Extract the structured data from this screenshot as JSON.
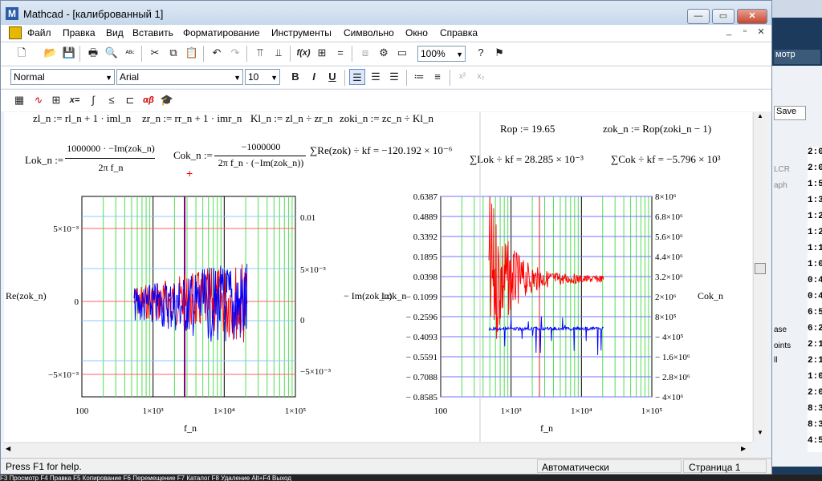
{
  "window": {
    "title": "Mathcad - [калиброванный 1]",
    "icon": "mathcad-icon"
  },
  "menu": [
    "Файл",
    "Правка",
    "Вид",
    "Вставить",
    "Форматирование",
    "Инструменты",
    "Символьно",
    "Окно",
    "Справка"
  ],
  "toolbar": {
    "zoom": "100%"
  },
  "format": {
    "style": "Normal",
    "font": "Arial",
    "size": "10",
    "bold": "B",
    "italic": "I",
    "underline": "U"
  },
  "math_toolbar": {
    "xeq": "x=",
    "alpha": "αβ"
  },
  "worksheet": {
    "row1": {
      "zl": "zl_n := rl_n + 1 · iml_n",
      "zr": "zr_n := rr_n + 1 · imr_n",
      "kl": "Kl_n := zl_n ÷ zr_n",
      "zoki": "zoki_n := zc_n ÷ Kl_n"
    },
    "rop": "Rop := 19.65",
    "zok": "zok_n := Rop(zoki_n − 1)",
    "lok_lhs": "Lok_n :=",
    "lok_num": "1000000 · −Im(zok_n)",
    "lok_den": "2π f_n",
    "cok_lhs": "Cok_n :=",
    "cok_num": "−1000000",
    "cok_den": "2π f_n · (−Im(zok_n))",
    "sum1": "∑Re(zok) ÷ kf = −120.192 × 10⁻⁶",
    "sum2": "∑Lok ÷ kf = 28.285 × 10⁻³",
    "sum3": "∑Cok ÷ kf = −5.796 × 10³"
  },
  "plot1": {
    "y_left_label": "Re(zok_n)",
    "y_right_label": "− Im(zok_n)",
    "x_label": "f_n",
    "y_left_ticks": [
      "5×10⁻³",
      "0",
      "−5×10⁻³"
    ],
    "y_right_ticks": [
      "0.01",
      "5×10⁻³",
      "0",
      "−5×10⁻³"
    ],
    "x_ticks": [
      "100",
      "1×10³",
      "1×10⁴",
      "1×10⁵"
    ]
  },
  "plot2": {
    "y_left_label": "Lok_n",
    "y_right_label": "Cok_n",
    "x_label": "f_n",
    "y_left_ticks": [
      "0.6387",
      "0.4889",
      "0.3392",
      "0.1895",
      "0.0398",
      "− 0.1099",
      "− 0.2596",
      "− 0.4093",
      "− 0.5591",
      "− 0.7088",
      "− 0.8585"
    ],
    "y_right_ticks": [
      "8×10⁶",
      "6.8×10⁶",
      "5.6×10⁶",
      "4.4×10⁶",
      "3.2×10⁶",
      "2×10⁶",
      "8×10⁵",
      "− 4×10⁵",
      "− 1.6×10⁶",
      "− 2.8×10⁶",
      "− 4×10⁶"
    ],
    "x_ticks": [
      "100",
      "1×10³",
      "1×10⁴",
      "1×10⁵"
    ]
  },
  "status": {
    "help": "Press F1 for help.",
    "mode": "Автоматически",
    "page": "Страница 1"
  },
  "background": {
    "labels": [
      "мотр",
      "Save",
      "LCR",
      "aph",
      "ase",
      "oints",
      "ll"
    ],
    "times": [
      "2:0",
      "2:0",
      "1:5",
      "1:3",
      "1:2",
      "1:2",
      "1:1",
      "1:0",
      "0:4",
      "0:4",
      "6:5",
      "6:2",
      "2:1",
      "2:1",
      "1:0",
      "2:0",
      "8:3",
      "8:3",
      "4:5"
    ],
    "fkeys": "F3 Просмотр   F4 Правка   F5 Копирование   F6 Перемещение   F7 Каталог   F8 Удаление   Alt+F4 Выход"
  },
  "colors": {
    "series_red": "#ff0000",
    "series_blue": "#0000ff",
    "grid_green": "#50e050",
    "grid_blue": "#7070ff",
    "grid_red": "#ff6060"
  }
}
